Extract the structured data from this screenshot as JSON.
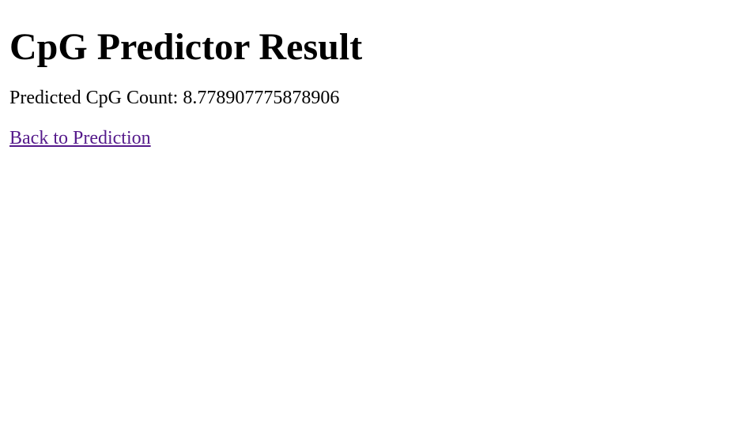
{
  "page": {
    "title": "CpG Predictor Result",
    "result_label": "Predicted CpG Count:",
    "result_value": "8.778907775878906",
    "back_link_text": "Back to Prediction"
  },
  "colors": {
    "text": "#000000",
    "visited_link": "#551a8b",
    "background": "#ffffff"
  }
}
